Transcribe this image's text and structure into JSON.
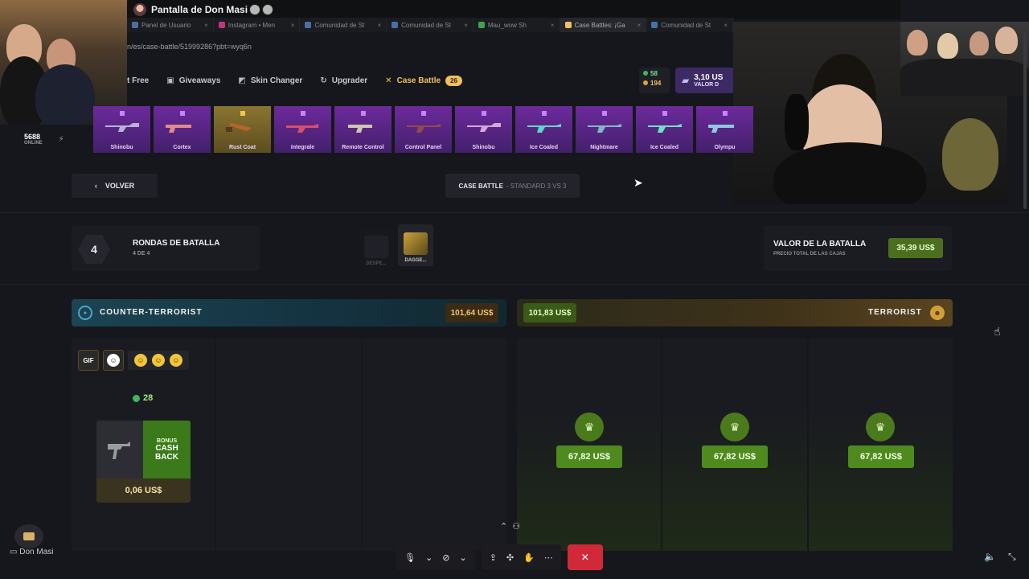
{
  "share": {
    "title": "Pantalla de Don Masi"
  },
  "tabs": [
    {
      "label": "Panel de Usuario",
      "active": false
    },
    {
      "label": "Instagram • Men",
      "active": false
    },
    {
      "label": "Comunidad de St",
      "active": false
    },
    {
      "label": "Comunidad de St",
      "active": false
    },
    {
      "label": "Mau_wow Sh",
      "active": false
    },
    {
      "label": "Case Battles: ¡Ga",
      "active": true
    },
    {
      "label": "Comunidad de St",
      "active": false
    }
  ],
  "address": {
    "url": "n/es/case-battle/51999286?pbt=wyq6n"
  },
  "nav": {
    "items": [
      {
        "label": "t Free"
      },
      {
        "label": "Giveaways"
      },
      {
        "label": "Skin Changer"
      },
      {
        "label": "Upgrader"
      },
      {
        "label": "Case Battle"
      }
    ],
    "badge": "26"
  },
  "balance": {
    "green": "58",
    "gold": "194"
  },
  "wallet": {
    "amount": "3,10 US",
    "label": "VALOR D"
  },
  "online": {
    "count": "5688",
    "label": "ONLINE"
  },
  "drops": [
    {
      "name": "Shinobu",
      "gold": false
    },
    {
      "name": "Cortex",
      "gold": false
    },
    {
      "name": "Rust Coat",
      "gold": true
    },
    {
      "name": "Integrale",
      "gold": false
    },
    {
      "name": "Remote Control",
      "gold": false
    },
    {
      "name": "Control Panel",
      "gold": false
    },
    {
      "name": "Shinobu",
      "gold": false
    },
    {
      "name": "Ice Coaled",
      "gold": false
    },
    {
      "name": "Nightmare",
      "gold": false
    },
    {
      "name": "Ice Coaled",
      "gold": false
    },
    {
      "name": "Olympu",
      "gold": false
    }
  ],
  "battle": {
    "back_label": "VOLVER",
    "type": "CASE BATTLE",
    "mode": "- STANDARD 3 VS 3",
    "round_number": "4",
    "rounds_title": "RONDAS DE BATALLA",
    "rounds_sub": "4 DE 4",
    "case1_name": "DESPE...",
    "case2_name": "DAGGE...",
    "value_title": "VALOR DE LA BATALLA",
    "value_sub": "PRECIO TOTAL DE LAS CAJAS",
    "value_amount": "35,39 US$"
  },
  "teams": {
    "ct": {
      "label": "COUNTER-TERRORIST",
      "total": "101,64 US$"
    },
    "t": {
      "label": "TERRORIST",
      "total": "101,83 US$"
    }
  },
  "player": {
    "gif_label": "GIF",
    "coins": "28",
    "bonus_l1": "BONUS",
    "bonus_l2": "CASH",
    "bonus_l3": "BACK",
    "item_price": "0,06 US$"
  },
  "winners": [
    "67,82 US$",
    "67,82 US$",
    "67,82 US$"
  ],
  "meeting": {
    "presenter": "Don Masi"
  },
  "colors": {
    "accent_gold": "#f0c060",
    "ct_blue": "#1c4452",
    "t_gold": "#5a4420",
    "win_green": "#4e8a1e",
    "end_call": "#d2293a"
  }
}
